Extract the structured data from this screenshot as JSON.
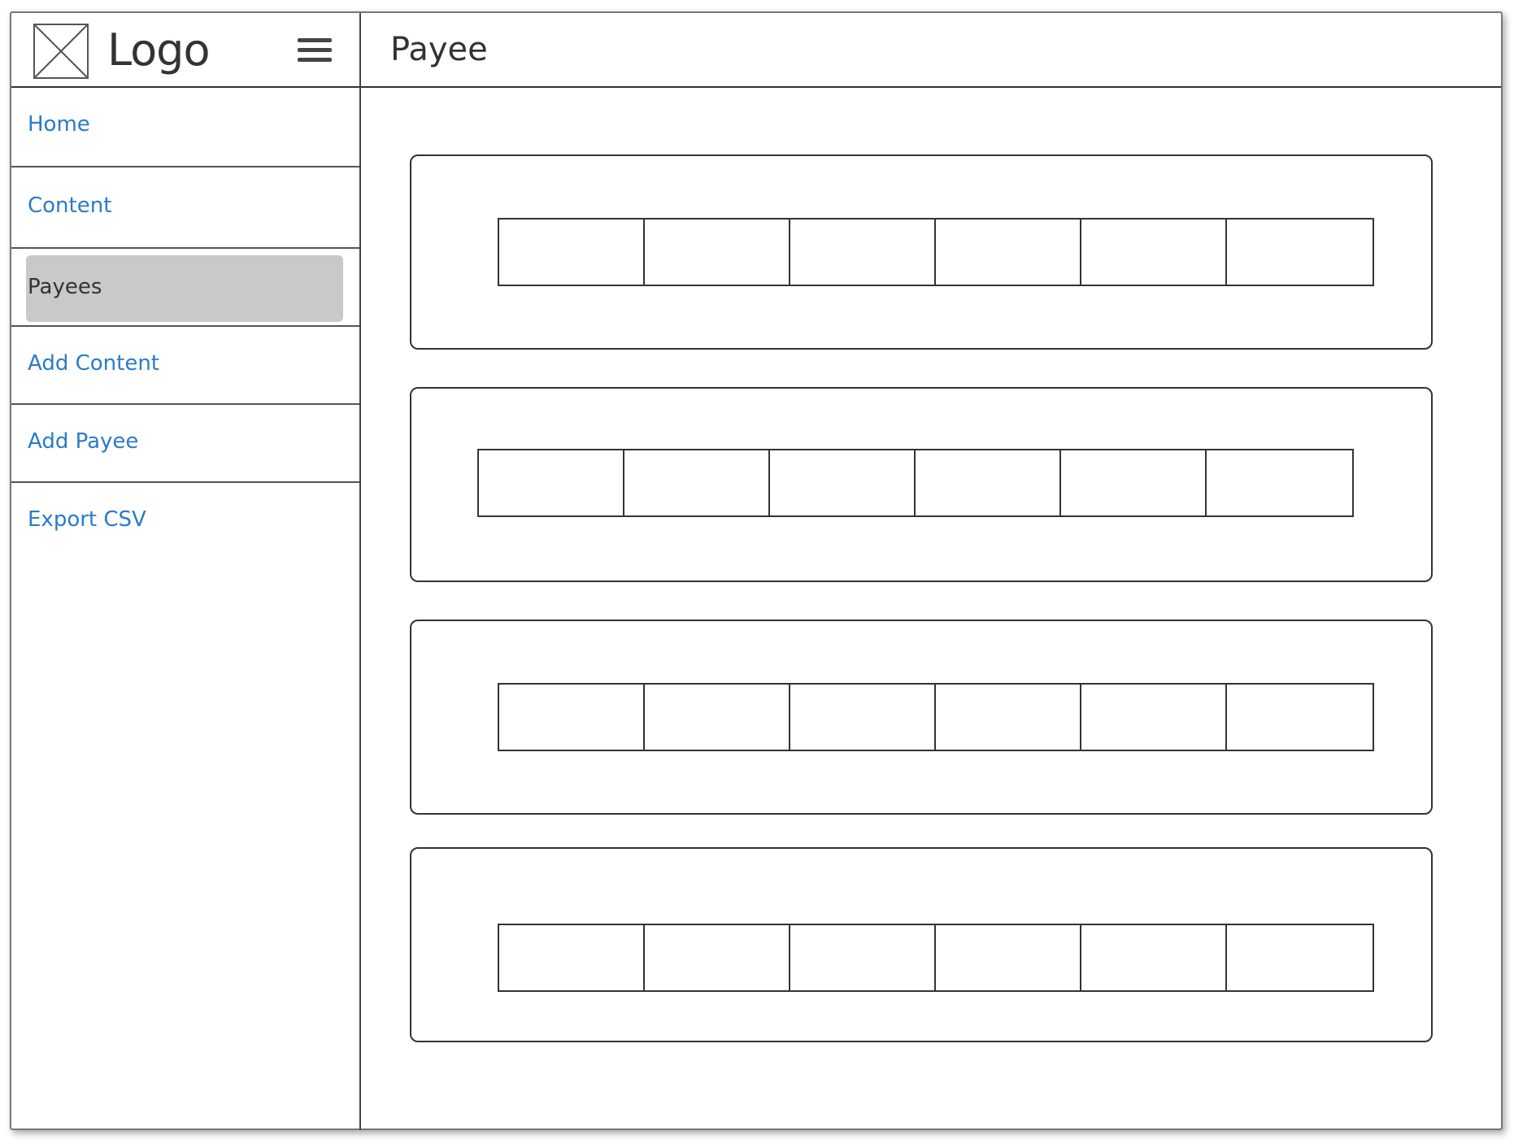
{
  "header": {
    "logo_text": "Logo",
    "logo_icon": "image-placeholder-icon",
    "menu_icon": "hamburger-menu-icon",
    "page_title": "Payee"
  },
  "sidebar": {
    "items": [
      {
        "label": "Home",
        "active": false
      },
      {
        "label": "Content",
        "active": false
      },
      {
        "label": "Payees",
        "active": true
      },
      {
        "label": "Add Content",
        "active": false
      },
      {
        "label": "Add Payee",
        "active": false
      },
      {
        "label": "Export CSV",
        "active": false
      }
    ]
  },
  "main": {
    "cards": [
      {
        "cells": [
          "",
          "",
          "",
          "",
          "",
          ""
        ]
      },
      {
        "cells": [
          "",
          "",
          "",
          "",
          "",
          ""
        ]
      },
      {
        "cells": [
          "",
          "",
          "",
          "",
          "",
          ""
        ]
      },
      {
        "cells": [
          "",
          "",
          "",
          "",
          "",
          ""
        ]
      }
    ]
  },
  "colors": {
    "link": "#2a7bc8",
    "active_highlight": "#c9c9c9",
    "line": "#333333"
  }
}
